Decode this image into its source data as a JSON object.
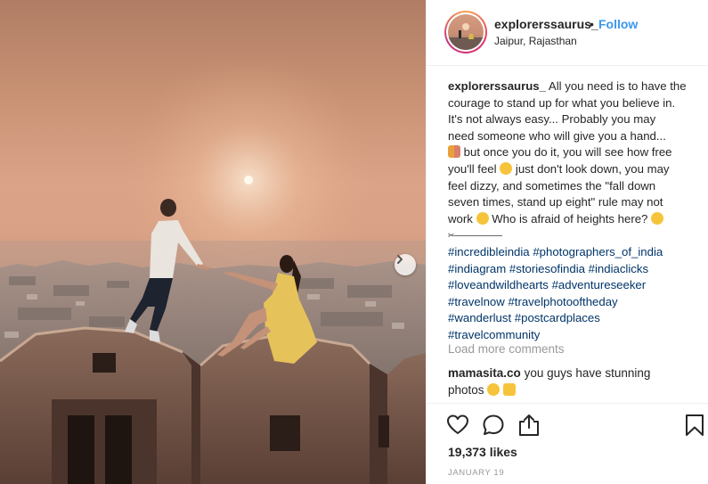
{
  "post": {
    "username": "explorerssaurus_",
    "follow_label": "Follow",
    "separator": "•",
    "location": "Jaipur, Rajasthan",
    "caption": {
      "line1": "All you need is to have the",
      "line2": "courage to stand up for what you believe in.",
      "line3": "It's not always easy... Probably you may",
      "line4": "need someone who will give you a hand...",
      "line5": "but once you do it, you will see how free",
      "line6a": "you'll feel",
      "line6b": "just don't look down, you may",
      "line7": "feel dizzy, and sometimes the \"fall down",
      "line8": "seven times, stand up eight\" rule may not",
      "line9a": "work",
      "line9b": "Who is afraid of heights here?",
      "divider": "✂---------------------------",
      "hashtags": [
        [
          "#incredibleindia",
          "#photographers_of_india"
        ],
        [
          "#indiagram",
          "#storiesofindia",
          "#indiaclicks"
        ],
        [
          "#loveandwildhearts",
          "#adventureseeker"
        ],
        [
          "#travelnow",
          "#travelphotooftheday"
        ],
        [
          "#wanderlust",
          "#postcardplaces"
        ],
        [
          "#travelcommunity"
        ]
      ]
    },
    "load_more": "Load more comments",
    "comment": {
      "username": "mamasita.co",
      "text_a": "you guys have stunning",
      "text_b": "photos"
    },
    "likes": "19,373 likes",
    "date": "JANUARY 19"
  },
  "icons": {
    "like": "heart-icon",
    "comment": "comment-icon",
    "share": "share-icon",
    "save": "bookmark-icon",
    "next": "chevron-right-icon"
  }
}
